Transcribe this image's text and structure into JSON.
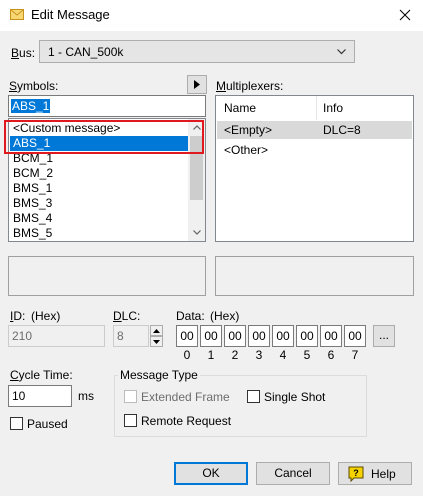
{
  "window": {
    "title": "Edit Message",
    "close_glyph": "✕"
  },
  "bus": {
    "label": "Bus:",
    "value": "1 - CAN_500k"
  },
  "symbols": {
    "label": "Symbols:",
    "search_value": "ABS_1",
    "items": [
      "<Custom message>",
      "ABS_1",
      "BCM_1",
      "BCM_2",
      "BMS_1",
      "BMS_3",
      "BMS_4",
      "BMS_5"
    ],
    "selected_index": 1
  },
  "multiplexers": {
    "label": "Multiplexers:",
    "columns": [
      "Name",
      "Info"
    ],
    "rows": [
      {
        "name": "<Empty>",
        "info": "DLC=8"
      },
      {
        "name": "<Other>",
        "info": ""
      }
    ]
  },
  "id_field": {
    "label": "ID:",
    "hint": "(Hex)",
    "value": "210"
  },
  "dlc_field": {
    "label": "DLC:",
    "value": "8"
  },
  "data_field": {
    "label": "Data:",
    "hint": "(Hex)",
    "bytes": [
      "00",
      "00",
      "00",
      "00",
      "00",
      "00",
      "00",
      "00"
    ],
    "indices": [
      "0",
      "1",
      "2",
      "3",
      "4",
      "5",
      "6",
      "7"
    ],
    "more_label": "..."
  },
  "cycle_time": {
    "label": "Cycle Time:",
    "value": "10",
    "unit": "ms"
  },
  "paused": {
    "label": "Paused",
    "checked": false
  },
  "message_type": {
    "title": "Message Type",
    "extended_frame": {
      "label": "Extended Frame",
      "checked": false,
      "enabled": false
    },
    "single_shot": {
      "label": "Single Shot",
      "checked": false
    },
    "remote_request": {
      "label": "Remote Request",
      "checked": false
    }
  },
  "buttons": {
    "ok": "OK",
    "cancel": "Cancel",
    "help": "Help"
  },
  "colors": {
    "selection": "#0078d7",
    "highlight_border": "#e0191f",
    "help_icon": "#f5d300"
  }
}
